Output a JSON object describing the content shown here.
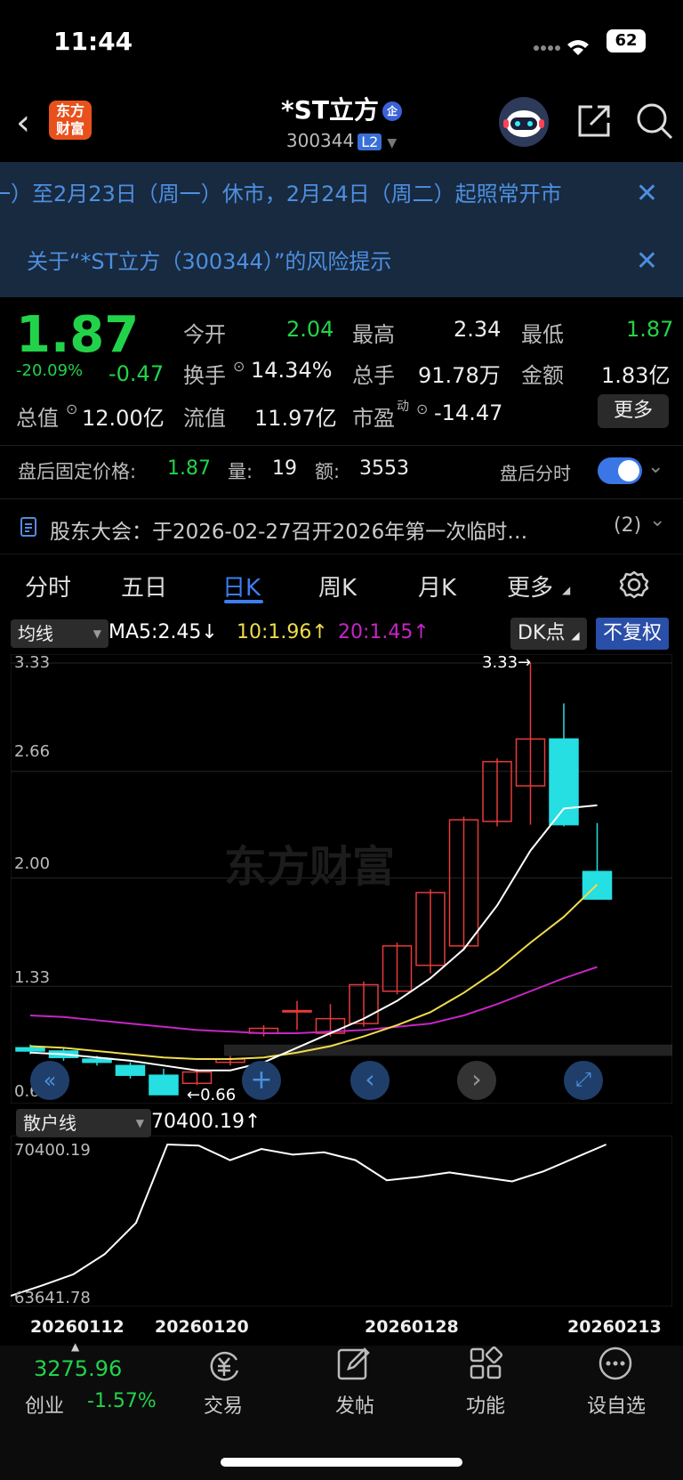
{
  "status": {
    "time": "11:44",
    "battery": "62"
  },
  "header": {
    "logo_line1": "东方",
    "logo_line2": "财富",
    "title": "*ST立方",
    "badge": "企",
    "code": "300344",
    "level": "L2"
  },
  "banners": [
    {
      "text": "一）至2月23日（周一）休市，2月24日（周二）起照常开市"
    },
    {
      "text": "关于“*ST立方（300344）”的风险提示"
    }
  ],
  "quote": {
    "price": "1.87",
    "pct": "-20.09%",
    "change": "-0.47",
    "fields": [
      {
        "label": "今开",
        "value": "2.04"
      },
      {
        "label": "最高",
        "value": "2.34"
      },
      {
        "label": "最低",
        "value": "1.87"
      },
      {
        "label": "换手",
        "value": "14.34%"
      },
      {
        "label": "总手",
        "value": "91.78万"
      },
      {
        "label": "金额",
        "value": "1.83亿"
      },
      {
        "label": "总值",
        "value": "12.00亿"
      },
      {
        "label": "流值",
        "value": "11.97亿"
      },
      {
        "label": "市盈",
        "sup": "动",
        "value": "-14.47"
      }
    ],
    "more": "更多"
  },
  "after_hours": {
    "label": "盘后固定价格:",
    "price": "1.87",
    "vol_label": "量:",
    "vol": "19",
    "amt_label": "额:",
    "amt": "3553",
    "timeshare": "盘后分时"
  },
  "notice": {
    "text": "股东大会：于2026-02-27召开2026年第一次临时…",
    "count": "(2)"
  },
  "tabs": [
    "分时",
    "五日",
    "日K",
    "周K",
    "月K",
    "更多"
  ],
  "ma_bar": {
    "selector": "均线",
    "ma5": "MA5:2.45↓",
    "ma10": "10:1.96↑",
    "ma20": "20:1.45↑",
    "dk": "DK点",
    "fq": "不复权"
  },
  "colors": {
    "up": "#e63a3a",
    "down": "#25dfe2",
    "ma5": "#ffffff",
    "ma10": "#f0dc4c",
    "ma20": "#c526c5",
    "green": "#22d34a",
    "blue": "#3d7ef0"
  },
  "chart_data": {
    "type": "candlestick",
    "ylim": [
      0.66,
      3.33
    ],
    "y_ticks": [
      "3.33",
      "2.66",
      "2.00",
      "1.33",
      "0.66"
    ],
    "max_label": "3.33→",
    "min_label": "←0.66",
    "candles": [
      {
        "o": 0.95,
        "c": 0.93,
        "h": 0.97,
        "l": 0.91
      },
      {
        "o": 0.93,
        "c": 0.89,
        "h": 0.95,
        "l": 0.87
      },
      {
        "o": 0.88,
        "c": 0.86,
        "h": 0.9,
        "l": 0.84
      },
      {
        "o": 0.84,
        "c": 0.78,
        "h": 0.86,
        "l": 0.76
      },
      {
        "o": 0.78,
        "c": 0.66,
        "h": 0.82,
        "l": 0.66
      },
      {
        "o": 0.73,
        "c": 0.8,
        "h": 0.82,
        "l": 0.72
      },
      {
        "o": 0.86,
        "c": 0.88,
        "h": 0.9,
        "l": 0.84
      },
      {
        "o": 1.04,
        "c": 1.07,
        "h": 1.09,
        "l": 1.02
      },
      {
        "o": 1.18,
        "c": 1.18,
        "h": 1.24,
        "l": 1.06
      },
      {
        "o": 1.04,
        "c": 1.13,
        "h": 1.22,
        "l": 1.02
      },
      {
        "o": 1.1,
        "c": 1.34,
        "h": 1.36,
        "l": 1.08
      },
      {
        "o": 1.3,
        "c": 1.58,
        "h": 1.6,
        "l": 1.28
      },
      {
        "o": 1.46,
        "c": 1.91,
        "h": 1.93,
        "l": 1.41
      },
      {
        "o": 1.58,
        "c": 2.36,
        "h": 2.38,
        "l": 1.55
      },
      {
        "o": 2.35,
        "c": 2.72,
        "h": 2.74,
        "l": 2.32
      },
      {
        "o": 2.57,
        "c": 2.86,
        "h": 3.33,
        "l": 2.33
      },
      {
        "o": 2.86,
        "c": 2.33,
        "h": 3.08,
        "l": 2.32
      },
      {
        "o": 2.04,
        "c": 1.87,
        "h": 2.34,
        "l": 1.87
      }
    ],
    "ma5": [
      0.92,
      0.91,
      0.89,
      0.87,
      0.84,
      0.81,
      0.81,
      0.86,
      0.95,
      1.04,
      1.13,
      1.24,
      1.38,
      1.56,
      1.83,
      2.17,
      2.43,
      2.45
    ],
    "ma10": [
      0.96,
      0.95,
      0.93,
      0.91,
      0.89,
      0.88,
      0.88,
      0.89,
      0.92,
      0.96,
      1.02,
      1.09,
      1.17,
      1.29,
      1.43,
      1.6,
      1.76,
      1.96
    ],
    "ma20": [
      1.15,
      1.14,
      1.12,
      1.1,
      1.08,
      1.06,
      1.05,
      1.04,
      1.04,
      1.05,
      1.06,
      1.08,
      1.1,
      1.15,
      1.22,
      1.3,
      1.38,
      1.45
    ],
    "indicator": {
      "selector": "散户线",
      "value": "70400.19↑",
      "ylim": [
        63641.78,
        70400.19
      ],
      "y_ticks": [
        "70400.19",
        "63641.78"
      ],
      "values": [
        63641.78,
        64100,
        64600,
        65500,
        66900,
        70400.19,
        70350,
        69700,
        70200,
        69950,
        70050,
        69700,
        68800,
        68950,
        69150,
        68950,
        68750,
        69200,
        69800,
        70400.19
      ]
    },
    "dates": [
      "20260112",
      "20260120",
      "20260128",
      "20260213"
    ]
  },
  "bottom": {
    "index_value": "3275.96",
    "index_name": "创业",
    "index_pct": "-1.57%",
    "items": [
      "交易",
      "发帖",
      "功能",
      "设自选"
    ]
  }
}
